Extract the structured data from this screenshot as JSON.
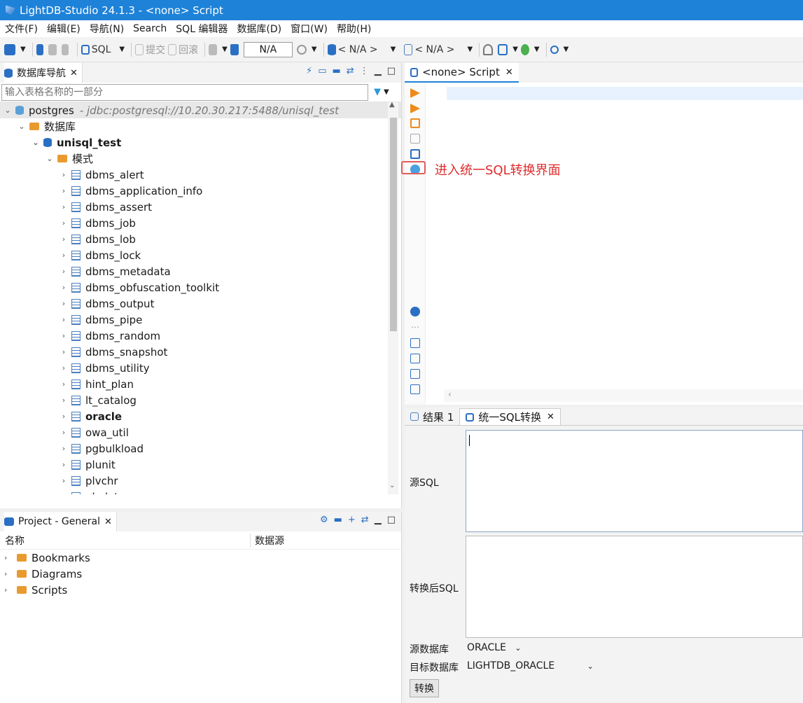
{
  "window": {
    "title": "LightDB-Studio 24.1.3 - <none> Script"
  },
  "menu": [
    "文件(F)",
    "编辑(E)",
    "导航(N)",
    "Search",
    "SQL 编辑器",
    "数据库(D)",
    "窗口(W)",
    "帮助(H)"
  ],
  "toolbar": {
    "sql_label": "SQL",
    "commit_label": "提交",
    "rollback_label": "回滚",
    "tx_mode": "N/A",
    "datasource": "< N/A >",
    "schema": "< N/A >"
  },
  "navigator": {
    "tab_label": "数据库导航",
    "filter_placeholder": "输入表格名称的一部分",
    "connection": {
      "name": "postgres",
      "url": "- jdbc:postgresql://10.20.30.217:5488/unisql_test"
    },
    "databases_label": "数据库",
    "database": "unisql_test",
    "schemas_label": "模式",
    "schemas": [
      "dbms_alert",
      "dbms_application_info",
      "dbms_assert",
      "dbms_job",
      "dbms_lob",
      "dbms_lock",
      "dbms_metadata",
      "dbms_obfuscation_toolkit",
      "dbms_output",
      "dbms_pipe",
      "dbms_random",
      "dbms_snapshot",
      "dbms_utility",
      "hint_plan",
      "lt_catalog",
      "oracle",
      "owa_util",
      "pgbulkload",
      "plunit",
      "plvchr",
      "plvdate"
    ],
    "bold_schema": "oracle"
  },
  "project": {
    "tab_label": "Project - General",
    "col_name": "名称",
    "col_source": "数据源",
    "items": [
      "Bookmarks",
      "Diagrams",
      "Scripts"
    ]
  },
  "editor": {
    "tab_label": "<none> Script",
    "callout": "进入统一SQL转换界面"
  },
  "bottom": {
    "tab_result": "结果 1",
    "tab_convert": "统一SQL转换",
    "source_sql_label": "源SQL",
    "target_sql_label": "转换后SQL",
    "source_db_label": "源数据库",
    "source_db": "ORACLE",
    "target_db_label": "目标数据库",
    "target_db": "LIGHTDB_ORACLE",
    "convert_button": "转换"
  }
}
